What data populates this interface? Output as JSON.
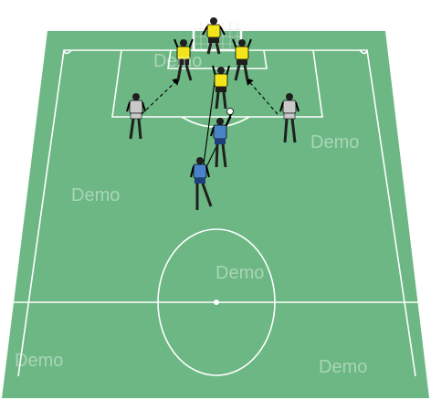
{
  "watermark": "Demo",
  "colors": {
    "pitch": "#6cb783",
    "lines": "#ffffff",
    "attacker_shirt": "#f2e51c",
    "defender_shirt": "#4a84c8",
    "neutral_shirt": "#c9c9c9",
    "dark_kit": "#1f1f1f",
    "pass_line": "#000000"
  },
  "players": [
    {
      "role": "goalkeeper",
      "kit": "yellow"
    },
    {
      "role": "attacker",
      "kit": "yellow"
    },
    {
      "role": "attacker",
      "kit": "yellow"
    },
    {
      "role": "attacker",
      "kit": "yellow"
    },
    {
      "role": "defender",
      "kit": "blue"
    },
    {
      "role": "defender",
      "kit": "blue"
    },
    {
      "role": "server",
      "kit": "grey"
    },
    {
      "role": "server",
      "kit": "grey"
    }
  ]
}
